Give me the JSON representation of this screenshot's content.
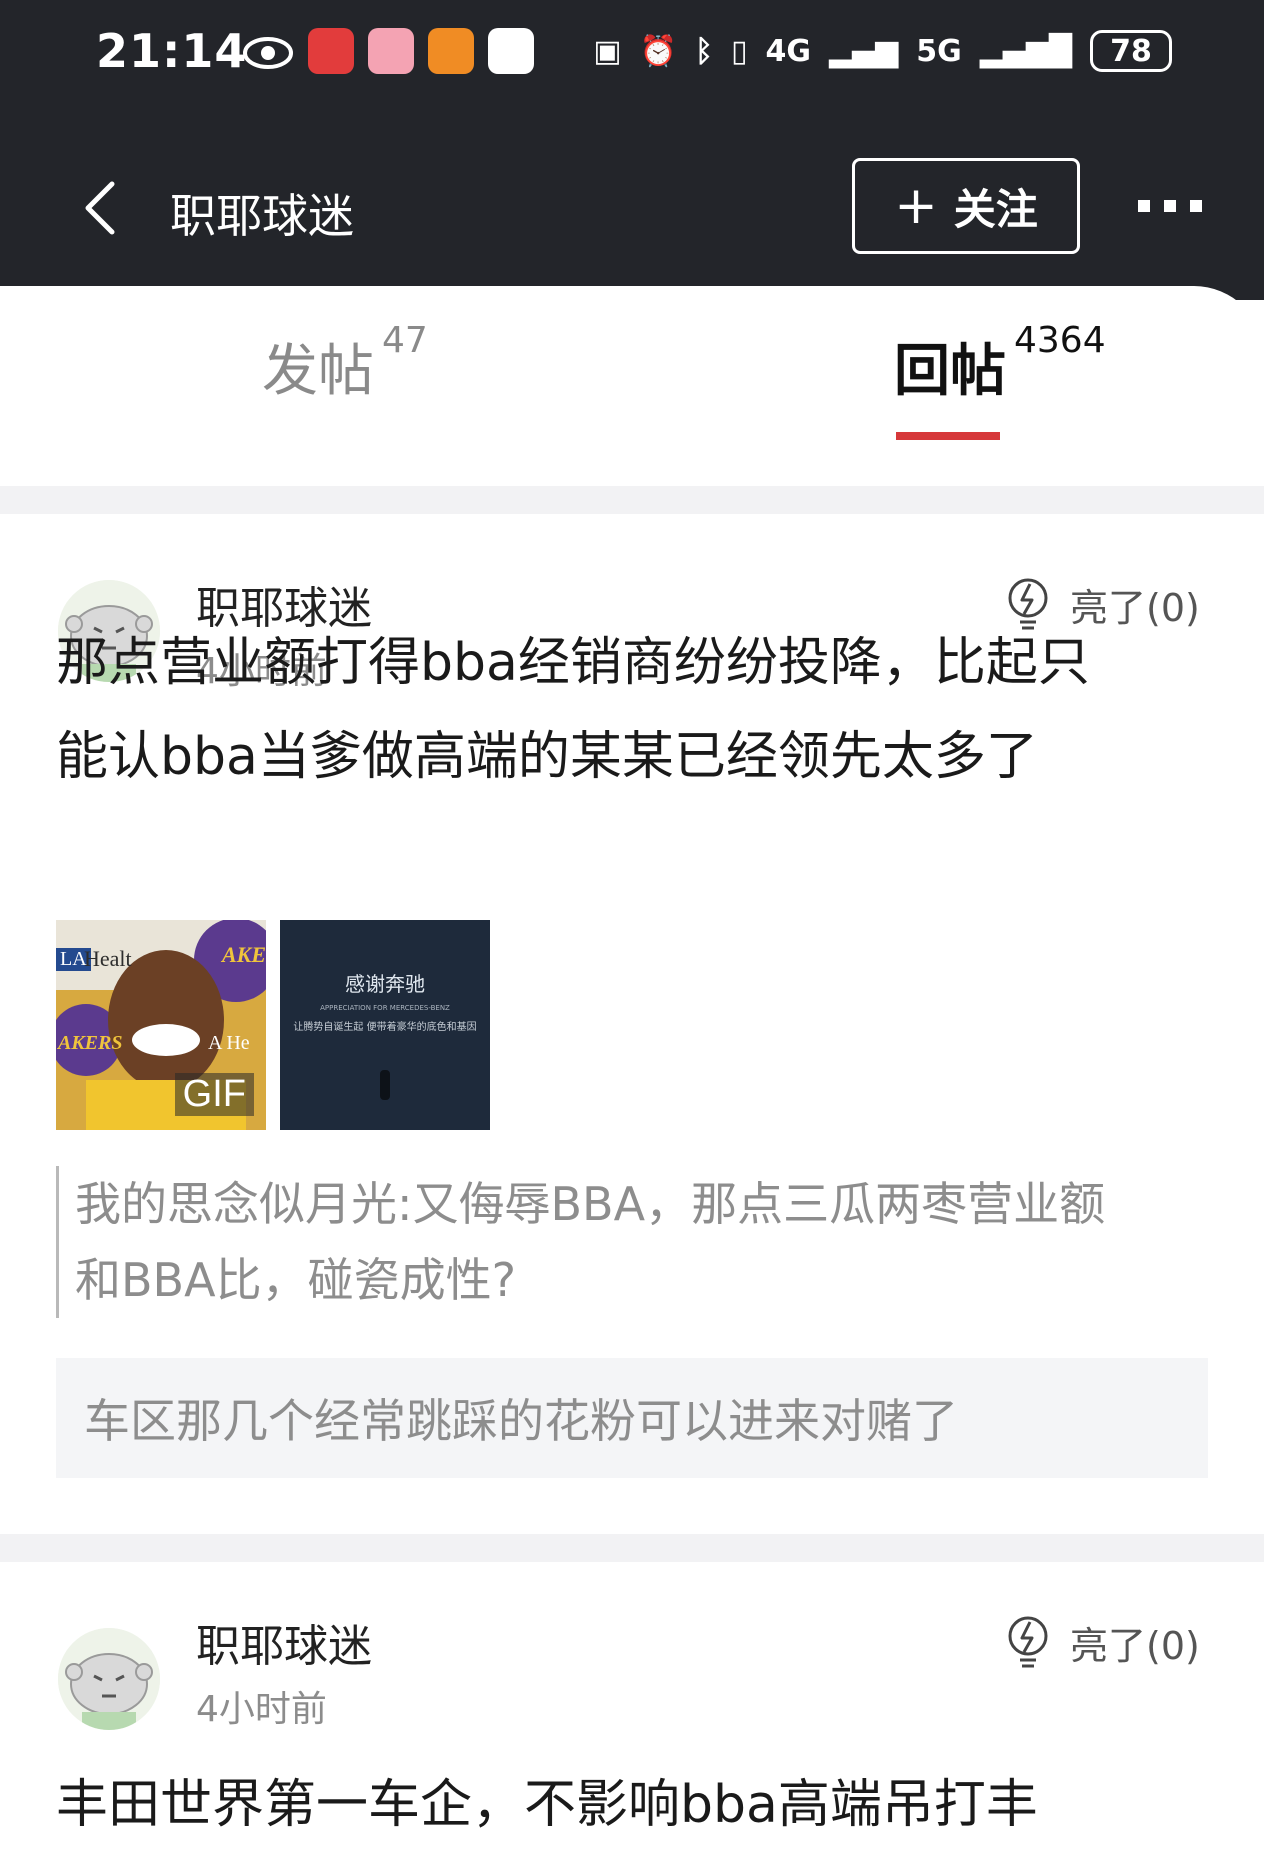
{
  "status_bar": {
    "time": "21:14",
    "network_4g": "4G",
    "network_5g": "5G",
    "battery": "78"
  },
  "navbar": {
    "title": "职耶球迷",
    "follow_label": "关注",
    "follow_plus": "+"
  },
  "tabs": [
    {
      "label": "发帖",
      "count": "47"
    },
    {
      "label": "回帖",
      "count": "4364"
    }
  ],
  "posts": [
    {
      "author": "职耶球迷",
      "time": "4小时前",
      "light_label": "亮了(0)",
      "content_line1": "那点营业额打得bba经销商纷纷投降，比起只",
      "content_line2": "能认bba当爹做高端的某某已经领先太多了",
      "images": {
        "img1_gif_badge": "GIF",
        "img1_text_a": "LA",
        "img1_text_b": "Healt",
        "img1_text_c": "AKE",
        "img1_text_d": "AKERS",
        "img1_text_e": "A He",
        "img2_title": "感谢奔驰",
        "img2_subtitle": "APPRECIATION FOR MERCEDES-BENZ",
        "img2_caption": "让腾势自诞生起 便带着豪华的底色和基因"
      },
      "quote_line1": "我的思念似月光:又侮辱BBA，那点三瓜两枣营业额",
      "quote_line2": "和BBA比，碰瓷成性?",
      "reply": "车区那几个经常跳踩的花粉可以进来对赌了"
    },
    {
      "author": "职耶球迷",
      "time": "4小时前",
      "light_label": "亮了(0)",
      "content_line1": "丰田世界第一车企，不影响bba高端吊打丰"
    }
  ]
}
